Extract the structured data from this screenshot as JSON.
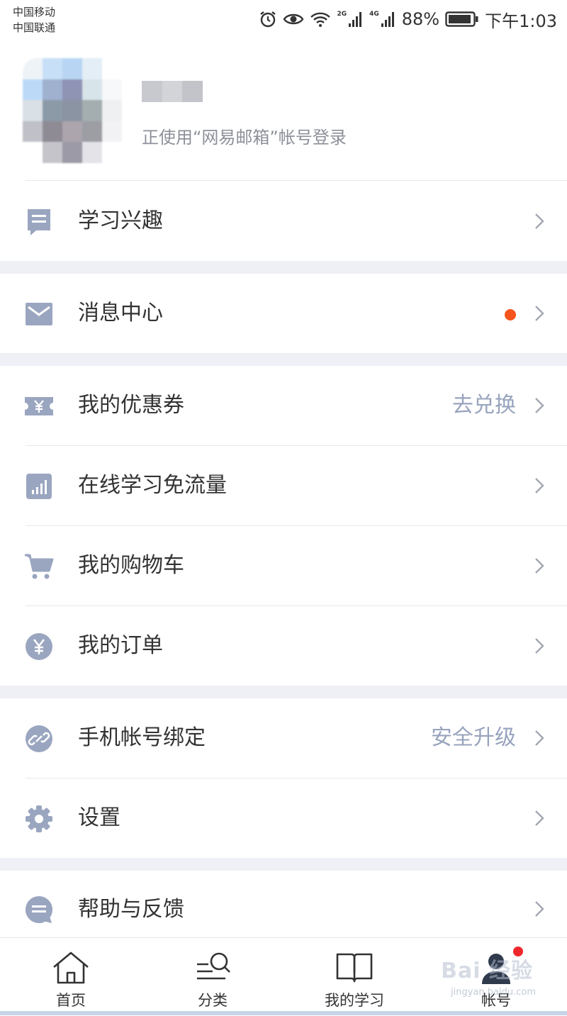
{
  "status_bar": {
    "carrier_1": "中国移动",
    "carrier_2": "中国联通",
    "net_2g": "2G",
    "net_4g": "4G",
    "battery": "88%",
    "time": "下午1:03"
  },
  "profile": {
    "login_text": "正使用“网易邮箱”帐号登录"
  },
  "menu": {
    "interest": {
      "label": "学习兴趣",
      "icon": "bookmark-icon"
    },
    "messages": {
      "label": "消息中心",
      "icon": "mail-icon",
      "unread_dot": true
    },
    "coupons": {
      "label": "我的优惠券",
      "right_text": "去兑换",
      "icon": "coupon-icon"
    },
    "free_data": {
      "label": "在线学习免流量",
      "icon": "signal-chart-icon"
    },
    "cart": {
      "label": "我的购物车",
      "icon": "cart-icon"
    },
    "orders": {
      "label": "我的订单",
      "icon": "yen-icon"
    },
    "phone_binding": {
      "label": "手机帐号绑定",
      "right_text": "安全升级",
      "icon": "link-icon"
    },
    "settings": {
      "label": "设置",
      "icon": "gear-icon"
    },
    "help": {
      "label": "帮助与反馈",
      "icon": "chat-bubble-icon"
    }
  },
  "tabbar": {
    "home": "首页",
    "category": "分类",
    "my_learning": "我的学习",
    "account": "帐号"
  },
  "watermark": {
    "text": "Bai 经验",
    "sub": "jingyan.baidu.com"
  },
  "colors": {
    "icon": "#9aa6c0",
    "secondary_text": "#98a3bd",
    "unread_dot": "#f5541c",
    "badge": "#f0282d",
    "section_gap": "#eef0f5"
  }
}
